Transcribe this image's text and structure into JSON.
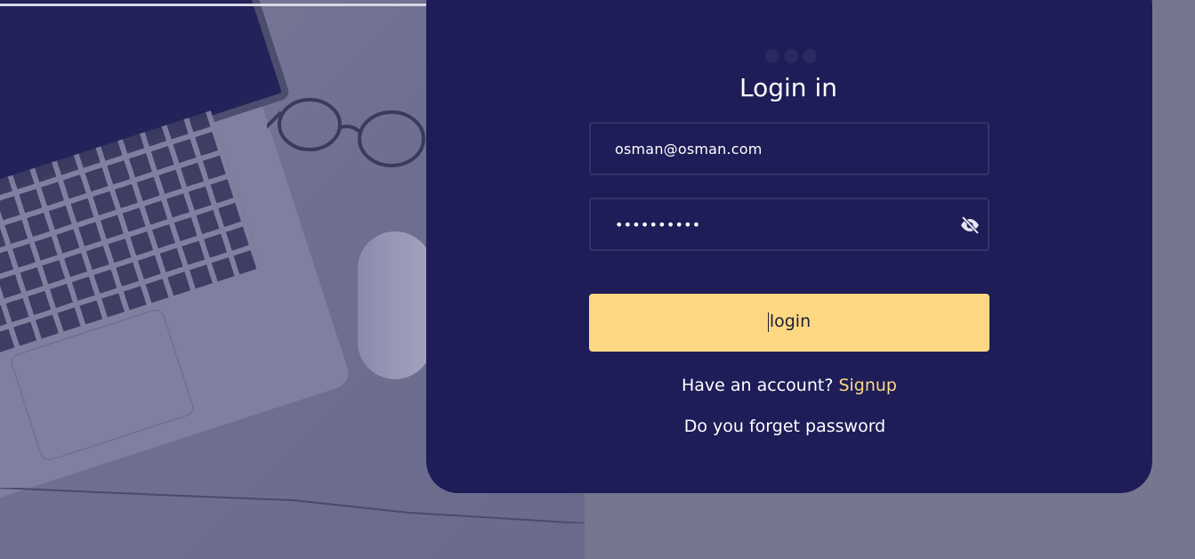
{
  "form": {
    "title": "Login in",
    "email_value": "osman@osman.com",
    "password_masked": "••••••••••",
    "login_label": "login",
    "have_account_text": "Have an account?",
    "signup_label": "Signup",
    "forgot_label": "Do you forget password"
  },
  "icons": {
    "password_toggle": "eye-off-icon",
    "loader": "three-dots-icon"
  },
  "colors": {
    "card_background": "#1e1d58",
    "accent": "#fdd883",
    "page_background": "#767691"
  }
}
